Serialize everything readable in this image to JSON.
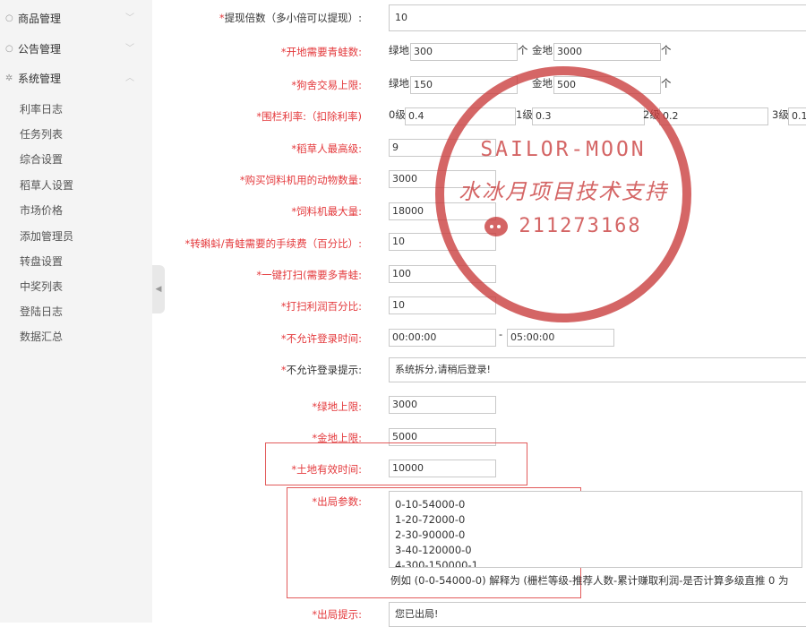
{
  "sidebar": {
    "groups": [
      {
        "label": "商品管理",
        "icon": "chat-bubble-icon"
      },
      {
        "label": "公告管理",
        "icon": "chat-bubble-icon"
      },
      {
        "label": "系统管理",
        "icon": "gear-icon"
      }
    ],
    "items": [
      "利率日志",
      "任务列表",
      "综合设置",
      "稻草人设置",
      "市场价格",
      "添加管理员",
      "转盘设置",
      "中奖列表",
      "登陆日志",
      "数据汇总"
    ]
  },
  "form": {
    "withdraw_multiple": {
      "label": "提现倍数（多小倍可以提现）:",
      "value": "10"
    },
    "open_frogs": {
      "label": "开地需要青蛙数:",
      "green_label": "绿地",
      "green_value": "300",
      "unit1": "个",
      "gold_label": "金地",
      "gold_value": "3000",
      "unit2": "个"
    },
    "kennel_limit": {
      "label": "狗舍交易上限:",
      "green_label": "绿地",
      "green_value": "150",
      "gold_label": "金地",
      "gold_value": "500",
      "unit": "个"
    },
    "fence_rate": {
      "label": "围栏利率:（扣除利率)",
      "l0_label": "0级",
      "l0_value": "0.4",
      "l1_label": "1级",
      "l1_value": "0.3",
      "l2_label": "2级",
      "l2_value": "0.2",
      "l3_label": "3级",
      "l3_value": "0.1"
    },
    "scarecrow_max": {
      "label": "稻草人最高级:",
      "value": "9"
    },
    "feeder_animals": {
      "label": "购买饲料机用的动物数量:",
      "value": "3000"
    },
    "feeder_max": {
      "label": "饲料机最大量:",
      "value": "18000"
    },
    "fee_percent": {
      "label": "转蝌蚪/青蛙需要的手续费（百分比）:",
      "value": "10"
    },
    "one_click_clean": {
      "label": "一键打扫(需要多青蛙:",
      "value": "100"
    },
    "clean_profit": {
      "label": "打扫利润百分比:",
      "value": "10"
    },
    "no_login_time": {
      "label": "不允许登录时间:",
      "start": "00:00:00",
      "sep": "-",
      "end": "05:00:00"
    },
    "no_login_tip": {
      "label": "不允许登录提示:",
      "value": "系统拆分,请稍后登录!"
    },
    "green_limit": {
      "label": "绿地上限:",
      "value": "3000"
    },
    "gold_limit": {
      "label": "金地上限:",
      "value": "5000"
    },
    "land_valid_time": {
      "label": "土地有效时间:",
      "value": "10000"
    },
    "exit_params": {
      "label": "出局参数:",
      "lines": [
        "0-10-54000-0",
        "1-20-72000-0",
        "2-30-90000-0",
        "3-40-120000-0",
        "4-300-150000-1"
      ],
      "hint": "例如 (0-0-54000-0) 解释为 (栅栏等级-推荐人数-累计赚取利润-是否计算多级直推 0 为"
    },
    "exit_tip": {
      "label": "出局提示:",
      "value": "您已出局!"
    }
  },
  "watermark": {
    "line1": "SAILOR-MOON",
    "line2": "水冰月项目技术支持",
    "line3": "211273168",
    "color": "#c93b3b"
  },
  "colors": {
    "required": "#e4393c",
    "highlight_border": "#e25b5b",
    "sidebar_bg": "#f4f4f4"
  }
}
